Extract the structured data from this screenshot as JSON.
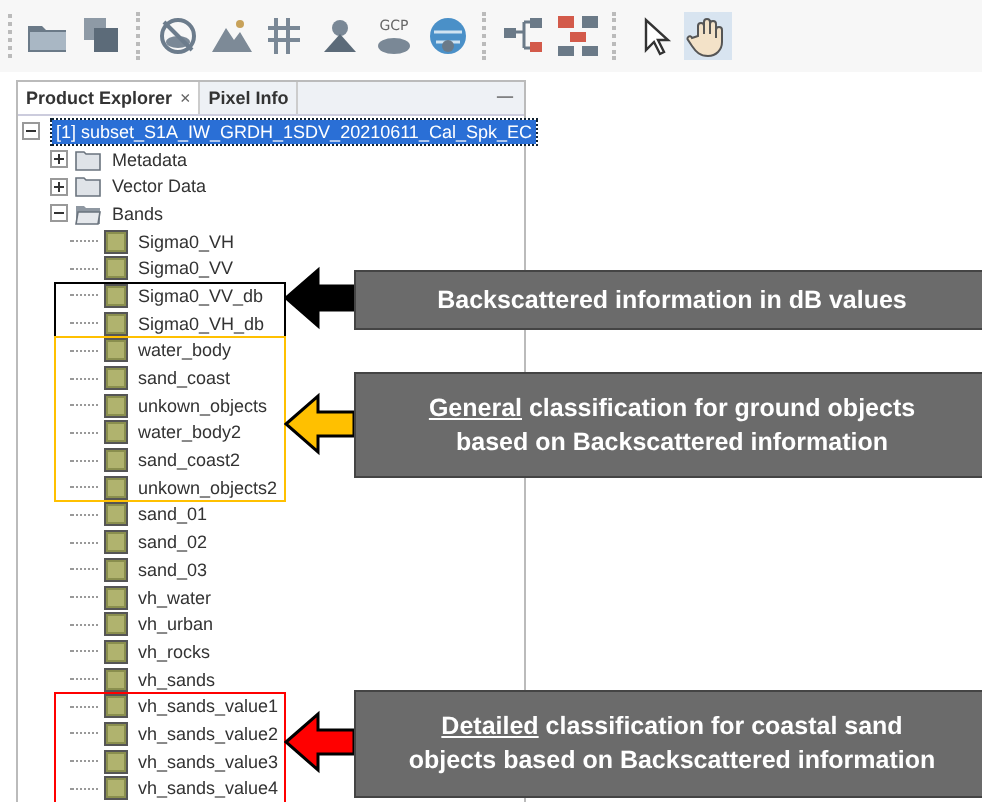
{
  "toolbar": {
    "gcp_label": "GCP"
  },
  "panel": {
    "tabs": [
      {
        "label": "Product Explorer",
        "selected": true,
        "close": "×"
      },
      {
        "label": "Pixel Info",
        "selected": false
      }
    ],
    "minimize": "—"
  },
  "tree": {
    "label": "[1] subset_S1A_IW_GRDH_1SDV_20210611_Cal_Spk_EC",
    "selected": true,
    "expanded": true,
    "children": [
      {
        "label": "Metadata",
        "expanded": false
      },
      {
        "label": "Vector Data",
        "expanded": false
      },
      {
        "label": "Bands",
        "expanded": true,
        "children": [
          {
            "label": "Sigma0_VH"
          },
          {
            "label": "Sigma0_VV"
          },
          {
            "label": "Sigma0_VV_db"
          },
          {
            "label": "Sigma0_VH_db"
          },
          {
            "label": "water_body"
          },
          {
            "label": "sand_coast"
          },
          {
            "label": "unkown_objects"
          },
          {
            "label": "water_body2"
          },
          {
            "label": "sand_coast2"
          },
          {
            "label": "unkown_objects2"
          },
          {
            "label": "sand_01"
          },
          {
            "label": "sand_02"
          },
          {
            "label": "sand_03"
          },
          {
            "label": "vh_water"
          },
          {
            "label": "vh_urban"
          },
          {
            "label": "vh_rocks"
          },
          {
            "label": "vh_sands"
          },
          {
            "label": "vh_sands_value1"
          },
          {
            "label": "vh_sands_value2"
          },
          {
            "label": "vh_sands_value3"
          },
          {
            "label": "vh_sands_value4"
          }
        ]
      }
    ]
  },
  "annotations": [
    {
      "color": "#000000",
      "text": "Backscattered information in dB values"
    },
    {
      "color": "#ffc000",
      "emphasis": "General",
      "text": " classification for ground objects based on Backscattered information"
    },
    {
      "color": "#ff0000",
      "emphasis": "Detailed",
      "text": " classification for coastal sand objects based on Backscattered information"
    }
  ]
}
